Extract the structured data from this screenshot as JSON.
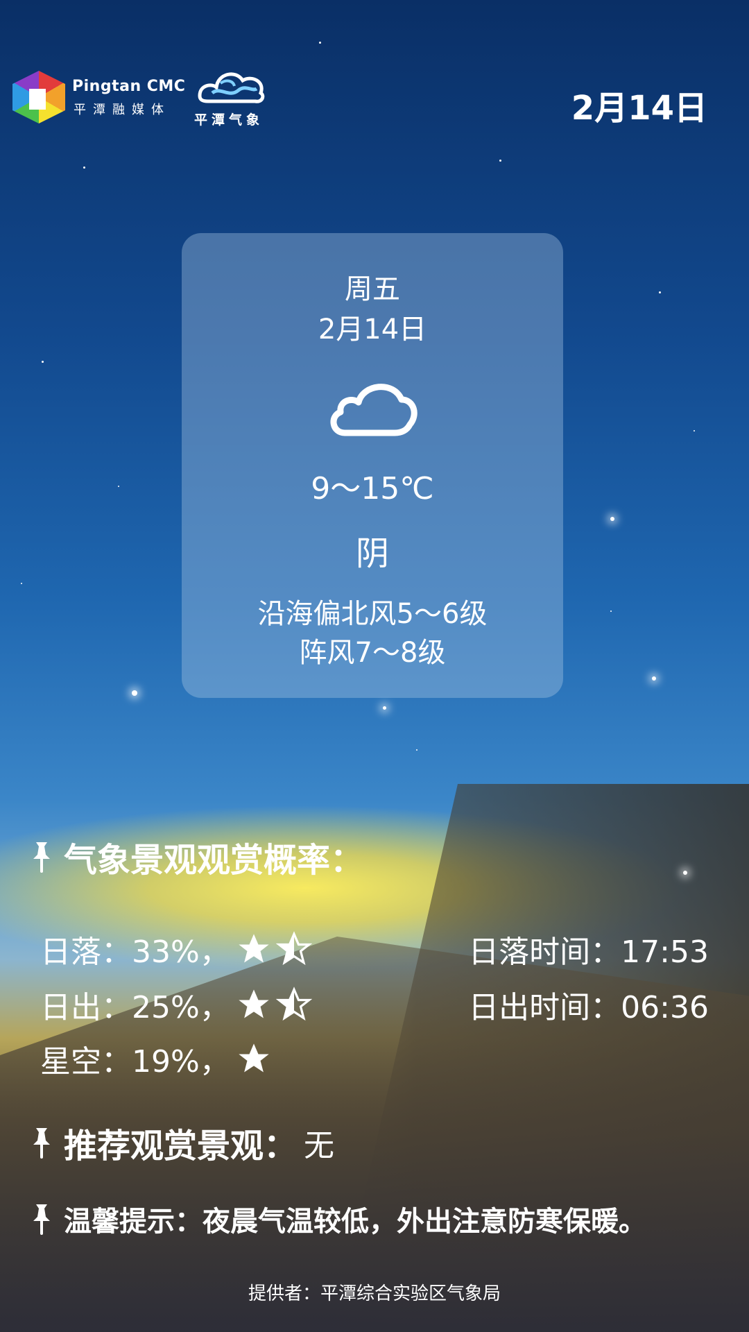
{
  "header": {
    "brand_en": "Pingtan CMC",
    "brand_cn": "平潭融媒体",
    "weather_logo_text": "平潭气象",
    "date": "2月14日"
  },
  "forecast": {
    "weekday": "周五",
    "date": "2月14日",
    "icon": "cloud-icon",
    "temperature": "9～15℃",
    "condition": "阴",
    "wind_line1": "沿海偏北风5～6级",
    "wind_line2": "阵风7～8级"
  },
  "scenery": {
    "title": "气象景观观赏概率：",
    "rows": [
      {
        "label": "日落：33%，",
        "rating": 1.5
      },
      {
        "label": "日出：25%，",
        "rating": 1.5
      },
      {
        "label": "星空：19%，",
        "rating": 1
      }
    ],
    "sunset_time": "日落时间：17:53",
    "sunrise_time": "日出时间：06:36"
  },
  "recommend": {
    "title": "推荐观赏景观：",
    "value": "无"
  },
  "tip": "温馨提示：夜晨气温较低，外出注意防寒保暖。",
  "footer": "提供者：平潭综合实验区气象局",
  "colors": {
    "card_bg": "#aac8e6",
    "sky_top": "#0a2f66",
    "sun_glow": "#ffee5a"
  }
}
